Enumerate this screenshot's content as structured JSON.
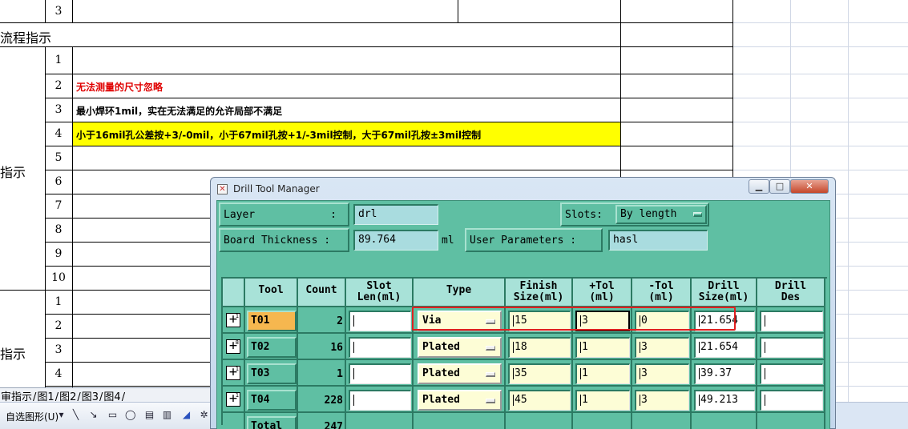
{
  "sheet": {
    "section_labels": [
      "流程指示",
      "指示",
      "指示"
    ],
    "top_row_num": "3",
    "block1_rows": [
      "1",
      "2",
      "3",
      "4",
      "5",
      "6",
      "7",
      "8",
      "9",
      "10"
    ],
    "block2_rows": [
      "1",
      "2",
      "3",
      "4"
    ],
    "note_row2": "无法测量的尺寸忽略",
    "note_row3": "最小焊环1mil，实在无法满足的允许局部不满足",
    "note_row4": "小于16mil孔公差按+3/-0mil，小于67mil孔按+1/-3mil控制，大于67mil孔按±3mil控制",
    "note_row2_color": "#e00000",
    "note_row4_bg": "#ffff00",
    "tabs": [
      "审指示",
      "图1",
      "图2",
      "图3",
      "图4"
    ],
    "draw_toolbar_label": "自选图形(U)"
  },
  "dialog": {
    "title": "Drill Tool Manager",
    "layer_label": "Layer",
    "layer_colon": ":",
    "layer_value": "drl",
    "slots_label": "Slots:",
    "slots_value": "By length",
    "board_thickness_label": "Board Thickness :",
    "board_thickness_value": "89.764",
    "board_thickness_unit": "ml",
    "user_params_label": "User Parameters :",
    "user_params_value": "hasl",
    "columns": {
      "tool": "Tool",
      "count": "Count",
      "slot_len_1": "Slot",
      "slot_len_2": "Len(ml)",
      "type": "Type",
      "finish_1": "Finish",
      "finish_2": "Size(ml)",
      "ptol_1": "+Tol",
      "ptol_2": "(ml)",
      "ntol_1": "-Tol",
      "ntol_2": "(ml)",
      "drill_1": "Drill",
      "drill_2": "Size(ml)",
      "des_1": "Drill",
      "des_2": "Des"
    },
    "rows": [
      {
        "tool": "T01",
        "count": "2",
        "type": "Via",
        "finish": "15",
        "ptol": "3",
        "ntol": "0",
        "drill": "21.654"
      },
      {
        "tool": "T02",
        "count": "16",
        "type": "Plated",
        "finish": "18",
        "ptol": "1",
        "ntol": "3",
        "drill": "21.654"
      },
      {
        "tool": "T03",
        "count": "1",
        "type": "Plated",
        "finish": "35",
        "ptol": "1",
        "ntol": "3",
        "drill": "39.37"
      },
      {
        "tool": "T04",
        "count": "228",
        "type": "Plated",
        "finish": "45",
        "ptol": "1",
        "ntol": "3",
        "drill": "49.213"
      }
    ],
    "total_label": "Total",
    "total_value": "247",
    "colors": {
      "client_bg": "#5fbfa3",
      "selected_tool": "#f6b74f",
      "highlight_box": "#e02020"
    }
  }
}
